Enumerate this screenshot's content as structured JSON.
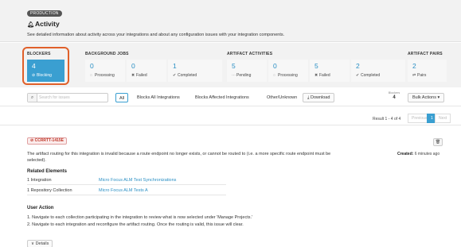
{
  "header": {
    "environment": "PRODUCTION",
    "title": "Activity",
    "description": "See detailed information about activity across your integrations and about any configuration issues with your integration components."
  },
  "summary": {
    "blockers": {
      "label": "BLOCKERS",
      "tiles": [
        {
          "value": "4",
          "label": "Blocking",
          "icon": "blocking-icon"
        }
      ]
    },
    "background_jobs": {
      "label": "BACKGROUND JOBS",
      "tiles": [
        {
          "value": "0",
          "label": "Processing",
          "icon": "processing-icon"
        },
        {
          "value": "0",
          "label": "Failed",
          "icon": "failed-icon"
        },
        {
          "value": "1",
          "label": "Completed",
          "icon": "completed-icon"
        }
      ]
    },
    "artifact_activities": {
      "label": "ARTIFACT ACTIVITIES",
      "tiles": [
        {
          "value": "5",
          "label": "Pending",
          "icon": "pending-icon"
        },
        {
          "value": "0",
          "label": "Processing",
          "icon": "processing-icon"
        },
        {
          "value": "5",
          "label": "Failed",
          "icon": "failed-icon"
        },
        {
          "value": "2",
          "label": "Completed",
          "icon": "completed-icon"
        }
      ]
    },
    "artifact_pairs": {
      "label": "ARTIFACT PAIRS",
      "tiles": [
        {
          "value": "2",
          "label": "Pairs",
          "icon": "pairs-icon"
        }
      ]
    }
  },
  "toolbar": {
    "search_placeholder": "Search for issues",
    "filters": [
      "All",
      "Blocks All Integrations",
      "Blocks Affected Integrations",
      "Other/Unknown"
    ],
    "download_label": "Download",
    "blockers_caption": "Blockers",
    "blockers_count": "4",
    "bulk_actions_label": "Bulk Actions"
  },
  "results": {
    "summary": "Result 1 - 4 of 4",
    "previous_label": "Previous",
    "current_page": "1",
    "next_label": "Next"
  },
  "issue": {
    "id": "CCRRTT-1415E",
    "created_label": "Created:",
    "created_value": "6 minutes ago",
    "description": "The artifact routing for this integration is invalid because a route endpoint no longer exists, or cannot be routed to (i.e. a more specific route endpoint must be selected).",
    "related_heading": "Related Elements",
    "related": [
      {
        "count": "1 Integration",
        "link": "Micro Focus ALM Test Synchronizations"
      },
      {
        "count": "1 Repository Collection",
        "link": "Micro Focus ALM Tests A"
      }
    ],
    "user_action_heading": "User Action",
    "actions": [
      "1. Navigate to each collection participating in the integration to review what is now selected under 'Manage Projects.'",
      "2. Navigate to each integration and reconfigure the artifact routing. Once the routing is valid, this issue will clear."
    ],
    "details_label": "Details"
  },
  "colors": {
    "accent": "#3a9fd1",
    "highlight": "#e0602a",
    "error": "#c0392b"
  }
}
